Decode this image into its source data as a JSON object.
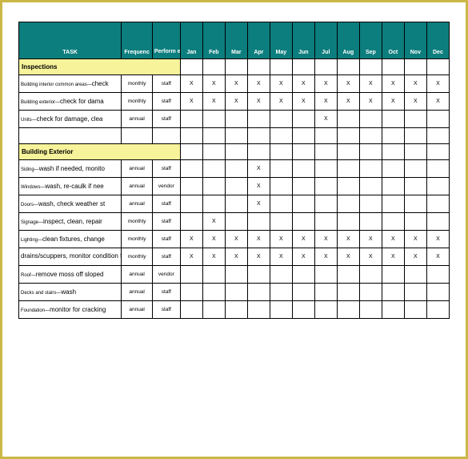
{
  "headers": {
    "task": "TASK",
    "frequency": "Frequenc",
    "performed_by": "Perform ed by",
    "months": [
      "Jan",
      "Feb",
      "Mar",
      "Apr",
      "May",
      "Jun",
      "Jul",
      "Aug",
      "Sep",
      "Oct",
      "Nov",
      "Dec"
    ]
  },
  "sections": [
    {
      "title": "Inspections",
      "rows": [
        {
          "prefix": "Building interior common areas—",
          "task": "check",
          "frequency": "monthly",
          "performed_by": "staff",
          "months": [
            "X",
            "X",
            "X",
            "X",
            "X",
            "X",
            "X",
            "X",
            "X",
            "X",
            "X",
            "X"
          ]
        },
        {
          "prefix": "Building exterior—",
          "task": "check for dama",
          "frequency": "monthly",
          "performed_by": "staff",
          "months": [
            "X",
            "X",
            "X",
            "X",
            "X",
            "X",
            "X",
            "X",
            "X",
            "X",
            "X",
            "X"
          ]
        },
        {
          "prefix": "Units—",
          "task": "check for damage, clea",
          "frequency": "annual",
          "performed_by": "staff",
          "months": [
            "",
            "",
            "",
            "",
            "",
            "",
            "X",
            "",
            "",
            "",
            "",
            ""
          ]
        }
      ]
    },
    {
      "title": "Building Exterior",
      "rows": [
        {
          "prefix": "Siding—",
          "task": "wash if needed, monito",
          "frequency": "annual",
          "performed_by": "staff",
          "months": [
            "",
            "",
            "",
            "X",
            "",
            "",
            "",
            "",
            "",
            "",
            "",
            ""
          ]
        },
        {
          "prefix": "Windows—",
          "task": "wash, re-caulk if nee",
          "frequency": "annual",
          "performed_by": "vendor",
          "months": [
            "",
            "",
            "",
            "X",
            "",
            "",
            "",
            "",
            "",
            "",
            "",
            ""
          ]
        },
        {
          "prefix": "Doors—",
          "task": "wash, check weather st",
          "frequency": "annual",
          "performed_by": "staff",
          "months": [
            "",
            "",
            "",
            "X",
            "",
            "",
            "",
            "",
            "",
            "",
            "",
            ""
          ]
        },
        {
          "prefix": "Signage—",
          "task": "inspect, clean, repair",
          "frequency": "monthly",
          "performed_by": "staff",
          "months": [
            "",
            "X",
            "",
            "",
            "",
            "",
            "",
            "",
            "",
            "",
            "",
            ""
          ]
        },
        {
          "prefix": "Lighting—",
          "task": "clean fixtures, change",
          "frequency": "monthly",
          "performed_by": "staff",
          "months": [
            "X",
            "X",
            "X",
            "X",
            "X",
            "X",
            "X",
            "X",
            "X",
            "X",
            "X",
            "X"
          ]
        },
        {
          "prefix": "",
          "task": "drains/scuppers, monitor condition for cracking, water pooling, leaks, loose flashing",
          "frequency": "monthly",
          "performed_by": "staff",
          "months": [
            "X",
            "X",
            "X",
            "X",
            "X",
            "X",
            "X",
            "X",
            "X",
            "X",
            "X",
            "X"
          ],
          "tall": true
        },
        {
          "prefix": "Roof—",
          "task": "remove moss off sloped",
          "frequency": "annual",
          "performed_by": "vendor",
          "months": [
            "",
            "",
            "",
            "",
            "",
            "",
            "",
            "",
            "",
            "",
            "",
            ""
          ]
        },
        {
          "prefix": "Decks and stairs—",
          "task": "wash",
          "frequency": "annual",
          "performed_by": "staff",
          "months": [
            "",
            "",
            "",
            "",
            "",
            "",
            "",
            "",
            "",
            "",
            "",
            ""
          ]
        },
        {
          "prefix": "Foundation—",
          "task": "monitor for cracking",
          "frequency": "annual",
          "performed_by": "staff",
          "months": [
            "",
            "",
            "",
            "",
            "",
            "",
            "",
            "",
            "",
            "",
            "",
            ""
          ]
        }
      ]
    }
  ]
}
